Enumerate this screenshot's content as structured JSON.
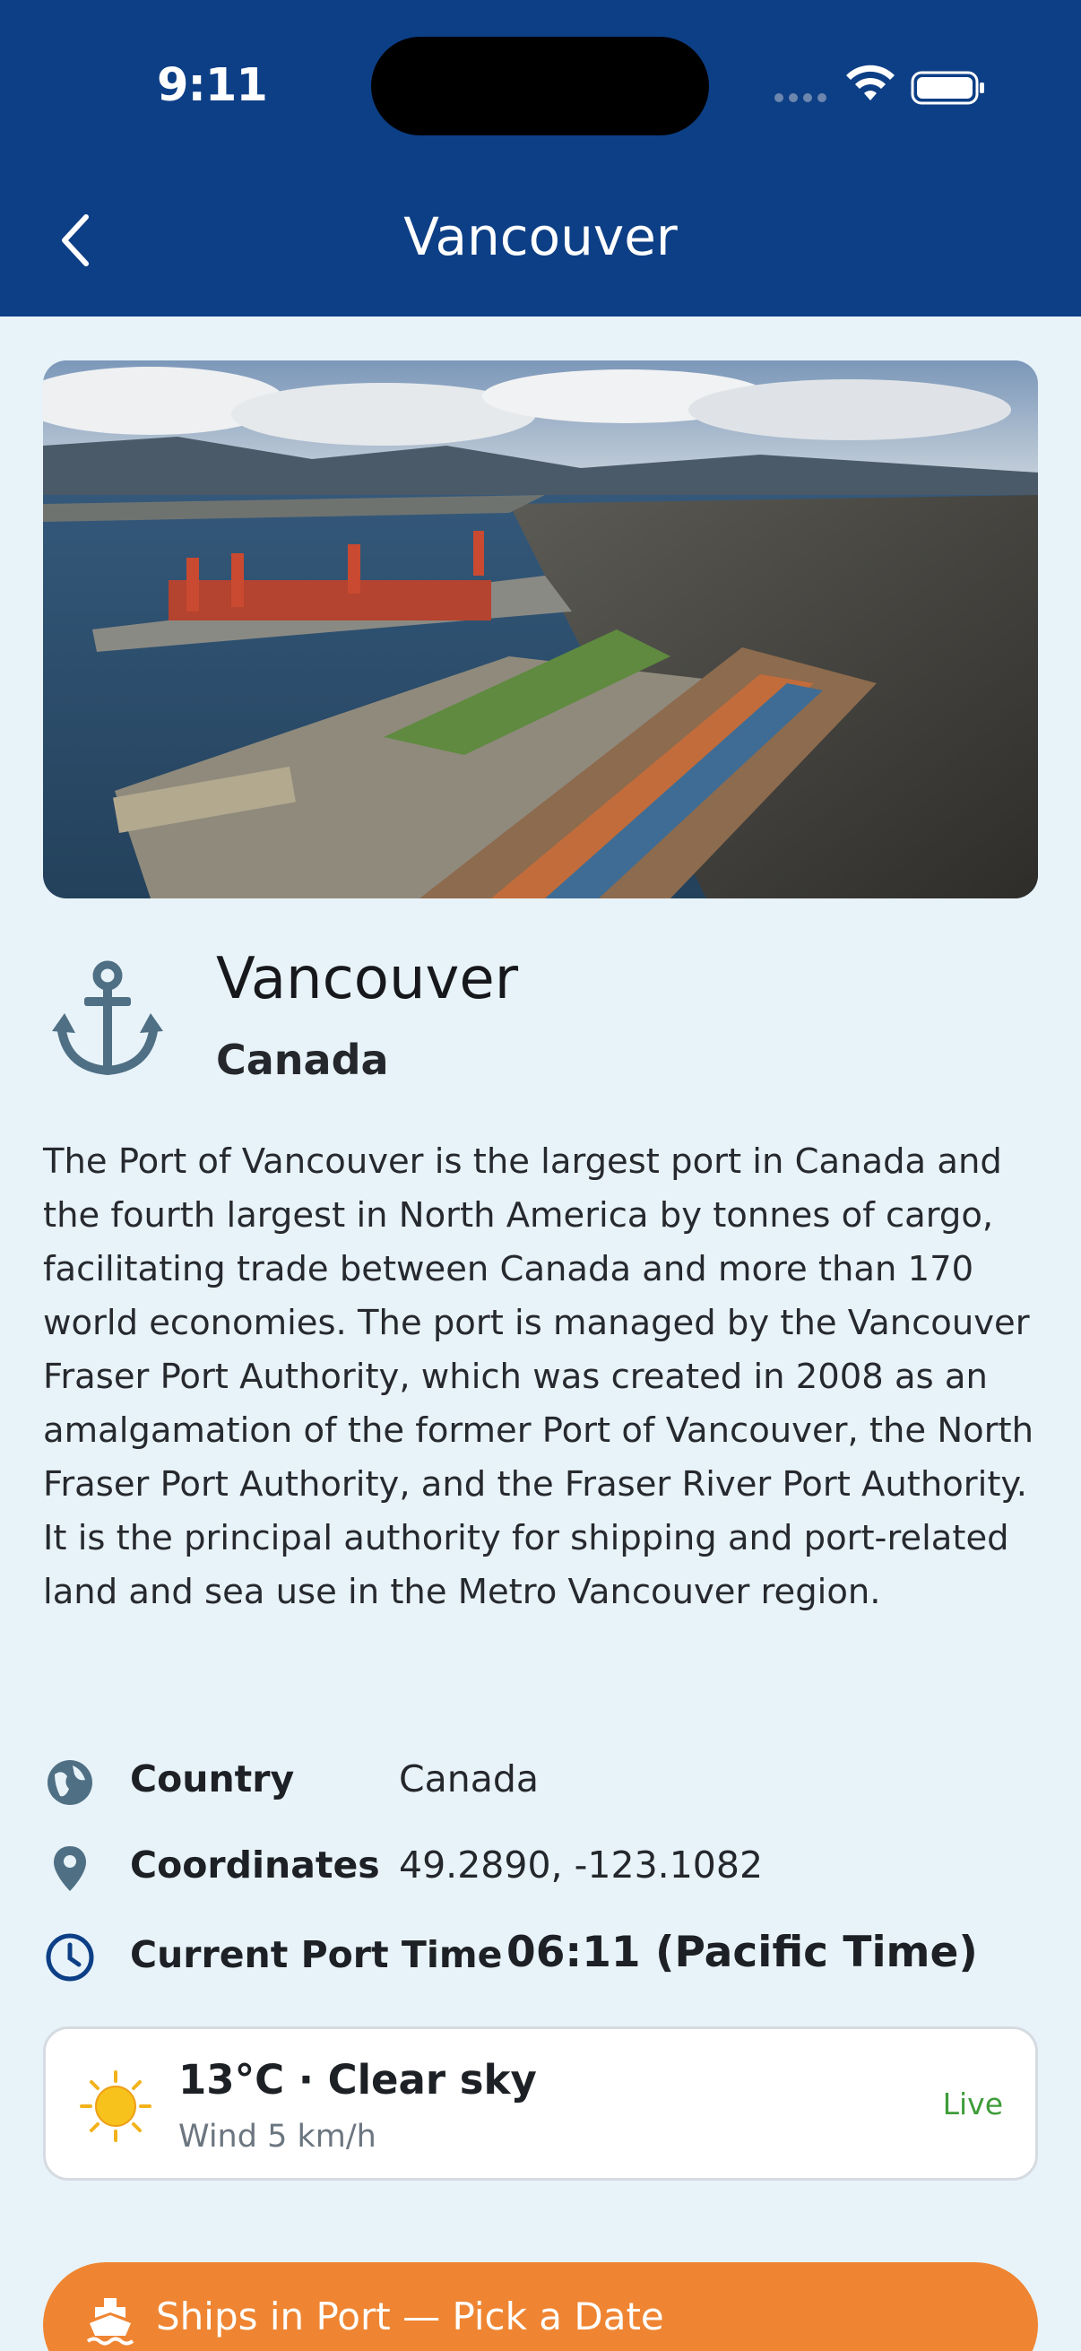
{
  "status_bar": {
    "time": "9:11"
  },
  "nav": {
    "title": "Vancouver",
    "back_icon": "chevron-left-icon"
  },
  "port": {
    "name": "Vancouver",
    "country": "Canada",
    "icon": "anchor-icon",
    "description": "The Port of Vancouver is the largest port in Canada and the fourth largest in North America by tonnes of cargo, facilitating trade between Canada and more than 170 world economies. The port is managed by the Vancouver Fraser Port Authority, which was created in 2008 as an amalgamation of the former Port of Vancouver, the North Fraser Port Authority, and the Fraser River Port Authority. It is the principal authority for shipping and port-related land and sea use in the Metro Vancouver region."
  },
  "info": {
    "country": {
      "label": "Country",
      "value": "Canada",
      "icon": "globe-icon"
    },
    "coordinates": {
      "label": "Coordinates",
      "value": "49.2890, -123.1082",
      "icon": "location-pin-icon"
    },
    "time": {
      "label": "Current Port Time",
      "value": "06:11 (Pacific Time)",
      "icon": "clock-icon"
    }
  },
  "weather": {
    "summary": "13°C  ·  Clear sky",
    "wind": "Wind 5 km/h",
    "status": "Live",
    "icon": "sun-icon"
  },
  "actions": {
    "ships_button": "Ships in Port — Pick a Date",
    "ships_icon": "ship-icon"
  },
  "colors": {
    "header": "#0d3f86",
    "background": "#e8f3f9",
    "accent_orange": "#ef8532",
    "live_green": "#3f9c3a",
    "icon_slate": "#4f6f84"
  }
}
